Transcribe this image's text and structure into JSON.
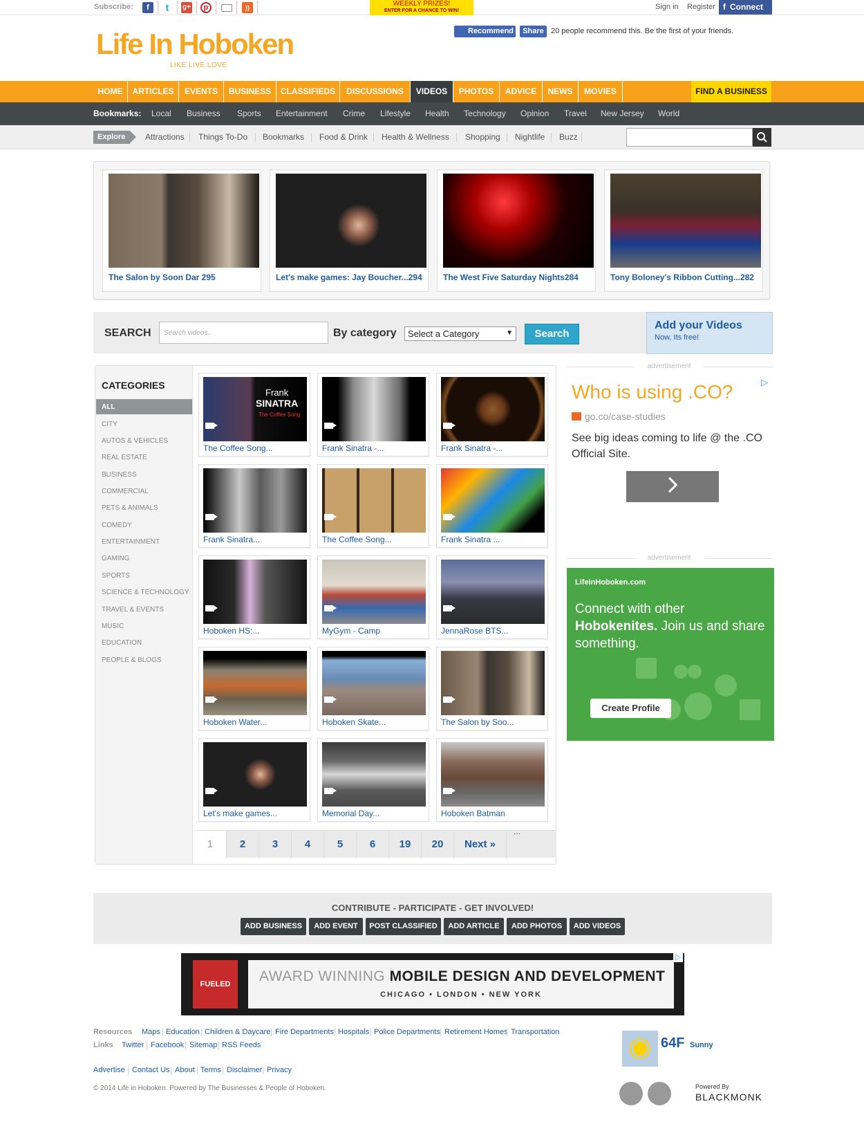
{
  "topbar": {
    "subscribe_label": "Subscribe:",
    "prizes_line1": "WEEKLY PRIZES!",
    "prizes_line2": "ENTER FOR A CHANCE TO WIN!",
    "signin": "Sign in",
    "register": "Register",
    "connect": "Connect",
    "social_icons": [
      "facebook-icon",
      "twitter-icon",
      "googleplus-icon",
      "pinterest-icon",
      "email-icon",
      "rss-icon"
    ]
  },
  "header": {
    "logo": "Life In Hoboken",
    "tagline": "LIKE.LIVE.LOVE",
    "fb_recommend": "Recommend",
    "fb_share": "Share",
    "fb_text": "20 people recommend this. Be the first of your friends."
  },
  "mainnav": {
    "items": [
      "HOME",
      "ARTICLES",
      "EVENTS",
      "BUSINESS",
      "CLASSIFIEDS",
      "DISCUSSIONS",
      "VIDEOS",
      "PHOTOS",
      "ADVICE",
      "NEWS",
      "MOVIES"
    ],
    "active": "VIDEOS",
    "find_business": "FIND A BUSINESS"
  },
  "bookmarks": {
    "label": "Bookmarks:",
    "items": [
      "Local",
      "Business",
      "Sports",
      "Entertainment",
      "Crime",
      "Lifestyle",
      "Health",
      "Technology",
      "Opinion",
      "Travel",
      "New Jersey",
      "World"
    ]
  },
  "explore": {
    "label": "Explore",
    "items": [
      "Attractions",
      "Things To-Do",
      "Bookmarks",
      "Food & Drink",
      "Health & Wellness",
      "Shopping",
      "Nightlife",
      "Buzz"
    ]
  },
  "featured": [
    {
      "caption": "The Salon by Soon Dar 295"
    },
    {
      "caption": "Let's make games: Jay Boucher...294"
    },
    {
      "caption": "The West Five Saturday Nights284"
    },
    {
      "caption": "Tony Boloney's Ribbon Cutting...282"
    }
  ],
  "video_search": {
    "label": "SEARCH",
    "placeholder": "Search videos..",
    "category_label": "By category",
    "category_selected": "Select a Category",
    "button": "Search",
    "add_title": "Add your Videos",
    "add_subtitle": "Now, Its free!"
  },
  "categories": {
    "title": "CATEGORIES",
    "selected": "ALL",
    "items": [
      "CITY",
      "AUTOS & VEHICLES",
      "REAL ESTATE",
      "BUSINESS",
      "COMMERCIAL",
      "PETS & ANIMALS",
      "COMEDY",
      "ENTERTAINMENT",
      "GAMING",
      "SPORTS",
      "SCIENCE & TECHNOLOGY",
      "TRAVEL & EVENTS",
      "MUSIC",
      "EDUCATION",
      "PEOPLE & BLOGS"
    ]
  },
  "thumb_text": {
    "frank": "Frank",
    "sinatra": "SINATRA",
    "coffee_song": "The Coffee Song"
  },
  "videos": [
    {
      "caption": "The Coffee Song..."
    },
    {
      "caption": "Frank Sinatra -..."
    },
    {
      "caption": "Frank Sinatra -..."
    },
    {
      "caption": "Frank Sinatra..."
    },
    {
      "caption": "The Coffee Song..."
    },
    {
      "caption": "Frank Sinatra ..."
    },
    {
      "caption": "Hoboken HS:..."
    },
    {
      "caption": "MyGym - Camp"
    },
    {
      "caption": "JennaRose BTS..."
    },
    {
      "caption": "Hoboken Water..."
    },
    {
      "caption": "Hoboken Skate..."
    },
    {
      "caption": "The Salon by Soo..."
    },
    {
      "caption": "Let's make games..."
    },
    {
      "caption": "Memorial Day..."
    },
    {
      "caption": "Hoboken Batman"
    }
  ],
  "pager": {
    "pages": [
      "1",
      "2",
      "3",
      "4",
      "5",
      "6",
      "19",
      "20"
    ],
    "current": "1",
    "next": "Next »",
    "ellipsis": "..."
  },
  "ads": {
    "label": "advertisement",
    "co_title": "Who is using .CO?",
    "co_url": "go.co/case-studies",
    "co_body": "See big ideas coming to life @ the .CO Official Site.",
    "green_brand": "LifeinHoboken.com",
    "green_line1": "Connect with other",
    "green_line2": "Hobokenites.",
    "green_line3": "Join us and share something.",
    "green_button": "Create Profile"
  },
  "contribute": {
    "title": "CONTRIBUTE - PARTICIPATE - GET INVOLVED!",
    "buttons": [
      "ADD BUSINESS",
      "ADD EVENT",
      "POST CLASSIFIED",
      "ADD ARTICLE",
      "ADD PHOTOS",
      "ADD VIDEOS"
    ]
  },
  "banner": {
    "brand": "FUELED",
    "line1_thin": "AWARD WINNING",
    "line1_bold": "MOBILE DESIGN AND DEVELOPMENT",
    "line2": "CHICAGO  •  LONDON  •  NEW YORK"
  },
  "footer": {
    "resources_label": "Resources",
    "resources": [
      "Maps",
      "Education",
      "Children & Daycare",
      "Fire Departments",
      "Hospitals",
      "Police Departments",
      "Retirement Homes",
      "Transportation"
    ],
    "links_label": "Links",
    "links": [
      "Twitter",
      "Facebook",
      "Sitemap",
      "RSS Feeds"
    ],
    "legal": [
      "Advertise",
      "Contact Us",
      "About",
      "Terms",
      "Disclaimer",
      "Privacy"
    ],
    "copyright": "© 2014 Life in Hoboken. Powered by The Businesses & People of Hoboken.",
    "temperature": "64F",
    "condition": "Sunny",
    "powered_by": "Powered By",
    "powered_brand": "BLACKMONK"
  }
}
